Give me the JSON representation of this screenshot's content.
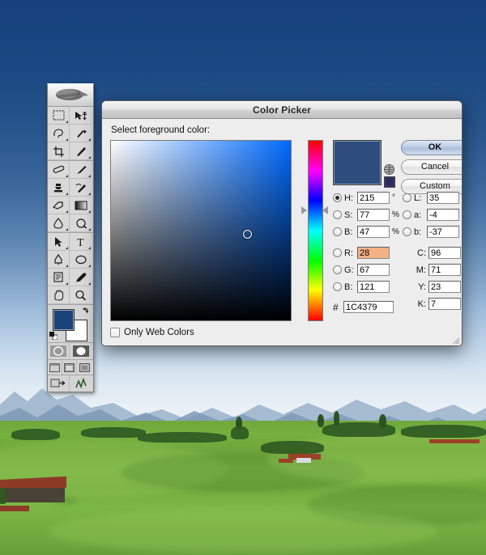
{
  "desktop": {
    "wallpaper_name": "alpine-meadow-photo",
    "sky_color_top": "#16417C",
    "sky_color_horizon": "#EEF3F8",
    "meadow_color": "#72AB3D"
  },
  "toolbar": {
    "name": "photoshop-tools-palette",
    "logo": "feather-logo",
    "tools": [
      [
        {
          "name": "marquee-tool-icon",
          "glyph": "marquee"
        },
        {
          "name": "move-tool-icon",
          "glyph": "move"
        }
      ],
      [
        {
          "name": "lasso-tool-icon",
          "glyph": "lasso"
        },
        {
          "name": "magic-wand-tool-icon",
          "glyph": "wand"
        }
      ],
      [
        {
          "name": "crop-tool-icon",
          "glyph": "crop"
        },
        {
          "name": "slice-tool-icon",
          "glyph": "slice"
        }
      ],
      [
        {
          "name": "healing-brush-tool-icon",
          "glyph": "heal"
        },
        {
          "name": "brush-tool-icon",
          "glyph": "brush"
        }
      ],
      [
        {
          "name": "clone-stamp-tool-icon",
          "glyph": "stamp"
        },
        {
          "name": "history-brush-tool-icon",
          "glyph": "history"
        }
      ],
      [
        {
          "name": "eraser-tool-icon",
          "glyph": "eraser"
        },
        {
          "name": "gradient-tool-icon",
          "glyph": "gradient"
        }
      ],
      [
        {
          "name": "blur-tool-icon",
          "glyph": "blur"
        },
        {
          "name": "dodge-tool-icon",
          "glyph": "dodge"
        }
      ],
      [
        {
          "name": "path-selection-tool-icon",
          "glyph": "arrow"
        },
        {
          "name": "type-tool-icon",
          "glyph": "type"
        }
      ],
      [
        {
          "name": "pen-tool-icon",
          "glyph": "pen"
        },
        {
          "name": "shape-tool-icon",
          "glyph": "shape"
        }
      ],
      [
        {
          "name": "notes-tool-icon",
          "glyph": "notes"
        },
        {
          "name": "eyedropper-tool-icon",
          "glyph": "eyedropper"
        }
      ],
      [
        {
          "name": "hand-tool-icon",
          "glyph": "hand"
        },
        {
          "name": "zoom-tool-icon",
          "glyph": "zoom"
        }
      ]
    ],
    "foreground_color": "#1C4379",
    "background_color": "#FFFFFF",
    "mode_buttons": [
      "standard-mask-mode",
      "quick-mask-mode"
    ],
    "screen_buttons": [
      "standard-screen-mode",
      "full-screen-with-menubar",
      "full-screen-mode"
    ],
    "jump_buttons": [
      "jump-to-imageready",
      "jump-to-app"
    ]
  },
  "dialog": {
    "title": "Color Picker",
    "prompt": "Select foreground color:",
    "buttons": {
      "ok": "OK",
      "cancel": "Cancel",
      "custom": "Custom"
    },
    "preview_color": "#2E4C7E",
    "web_safe_swatch_color": "#333366",
    "footer_checkbox": {
      "label": "Only Web Colors",
      "checked": false
    },
    "sb_field": {
      "marker_x_pct": 76,
      "marker_y_pct": 52
    },
    "hue_slider": {
      "position_pct": 39
    },
    "selected_model": "H",
    "hsb": [
      {
        "name": "H",
        "label": "H:",
        "value": "215",
        "unit": "°",
        "selected": true
      },
      {
        "name": "S",
        "label": "S:",
        "value": "77",
        "unit": "%",
        "selected": false
      },
      {
        "name": "B",
        "label": "B:",
        "value": "47",
        "unit": "%",
        "selected": false
      }
    ],
    "rgb": [
      {
        "name": "R",
        "label": "R:",
        "value": "28",
        "unit": "",
        "selected": false,
        "highlighted": true
      },
      {
        "name": "G",
        "label": "G:",
        "value": "67",
        "unit": "",
        "selected": false,
        "highlighted": false
      },
      {
        "name": "B2",
        "label": "B:",
        "value": "121",
        "unit": "",
        "selected": false,
        "highlighted": false
      }
    ],
    "lab": [
      {
        "name": "L",
        "label": "L:",
        "value": "35",
        "unit": "",
        "selected": false
      },
      {
        "name": "a",
        "label": "a:",
        "value": "-4",
        "unit": "",
        "selected": false
      },
      {
        "name": "b",
        "label": "b:",
        "value": "-37",
        "unit": "",
        "selected": false
      }
    ],
    "cmyk": [
      {
        "name": "C",
        "label": "C:",
        "value": "96",
        "unit": "%"
      },
      {
        "name": "M",
        "label": "M:",
        "value": "71",
        "unit": "%"
      },
      {
        "name": "Y",
        "label": "Y:",
        "value": "23",
        "unit": "%"
      },
      {
        "name": "K",
        "label": "K:",
        "value": "7",
        "unit": "%"
      }
    ],
    "hex": {
      "label": "#",
      "value": "1C4379"
    }
  }
}
